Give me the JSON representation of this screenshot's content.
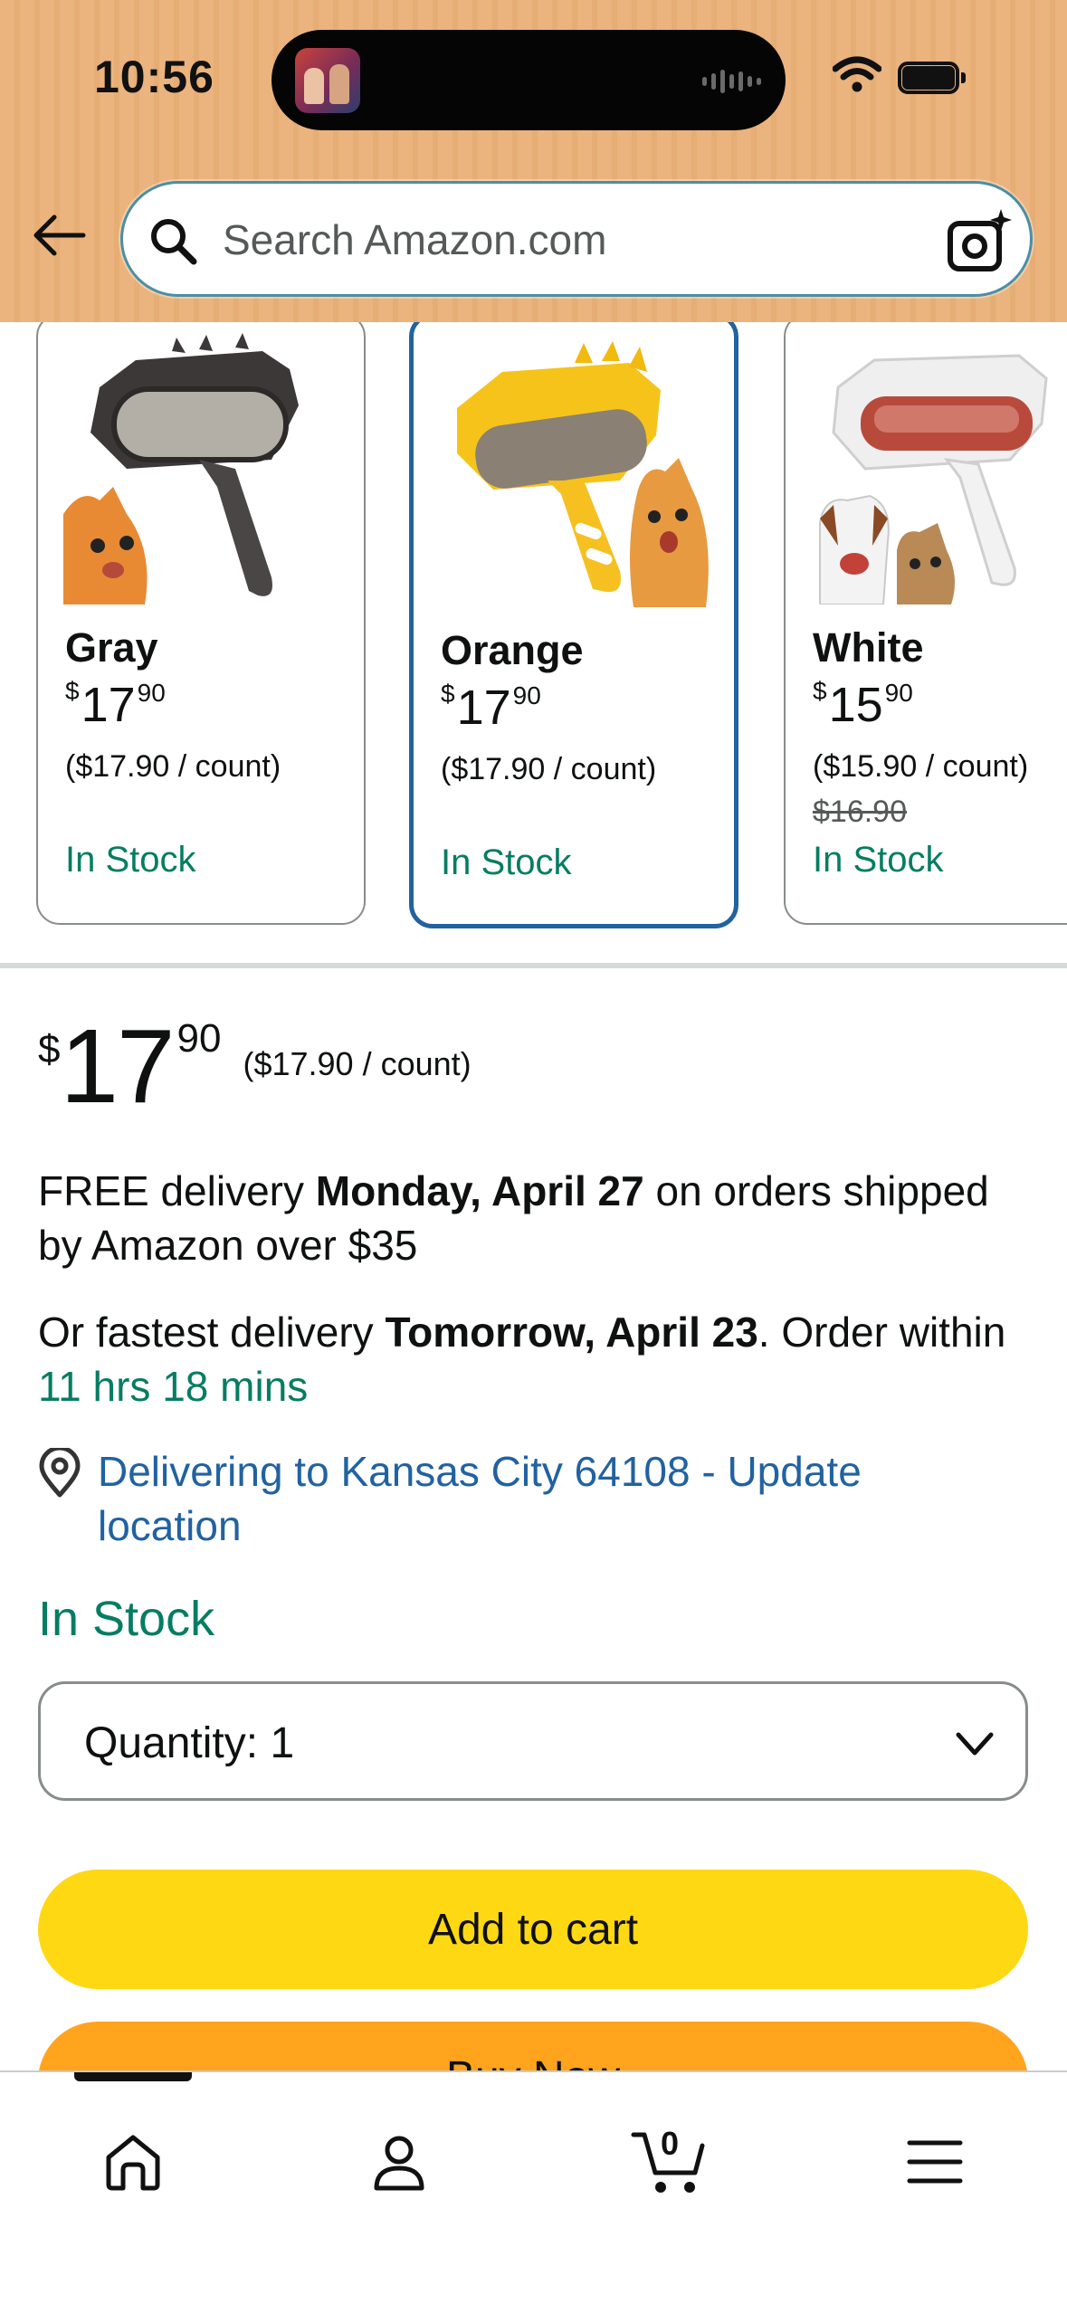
{
  "status_bar": {
    "time": "10:56"
  },
  "search": {
    "placeholder": "Search Amazon.com"
  },
  "variants": [
    {
      "name": "Gray",
      "price_whole": "17",
      "price_cents": "90",
      "currency": "$",
      "unit_price": "($17.90 / count)",
      "old_price": "",
      "stock": "In Stock",
      "color": "#4a4645"
    },
    {
      "name": "Orange",
      "price_whole": "17",
      "price_cents": "90",
      "currency": "$",
      "unit_price": "($17.90 / count)",
      "old_price": "",
      "stock": "In Stock",
      "color": "#f6c31a",
      "selected": true
    },
    {
      "name": "White",
      "price_whole": "15",
      "price_cents": "90",
      "currency": "$",
      "unit_price": "($15.90 / count)",
      "old_price": "$16.90",
      "stock": "In Stock",
      "color": "#eeeeee"
    }
  ],
  "buybox": {
    "currency": "$",
    "price_whole": "17",
    "price_cents": "90",
    "unit_price": "($17.90 / count)",
    "free_delivery": {
      "prefix": "FREE delivery ",
      "date": "Monday, April 27",
      "suffix": " on orders shipped by Amazon over $35"
    },
    "fast_delivery": {
      "prefix": "Or fastest delivery ",
      "date": "Tomorrow, April 23",
      "middle": ". Order within ",
      "countdown": "11 hrs 18 mins"
    },
    "location": "Delivering to Kansas City 64108 - Update location",
    "stock": "In Stock",
    "quantity_label": "Quantity:",
    "quantity_value": "1",
    "add_to_cart": "Add to cart",
    "buy_now": "Buy Now"
  },
  "bottom_nav": {
    "items": [
      {
        "icon": "home-icon"
      },
      {
        "icon": "account-icon"
      },
      {
        "icon": "cart-icon"
      },
      {
        "icon": "menu-icon"
      }
    ],
    "cart_count": "0"
  },
  "colors": {
    "header_bg": "#ebb47e",
    "link_blue": "#2162a1",
    "stock_green": "#067d62",
    "add_to_cart": "#ffd814",
    "buy_now": "#ffa41c"
  }
}
